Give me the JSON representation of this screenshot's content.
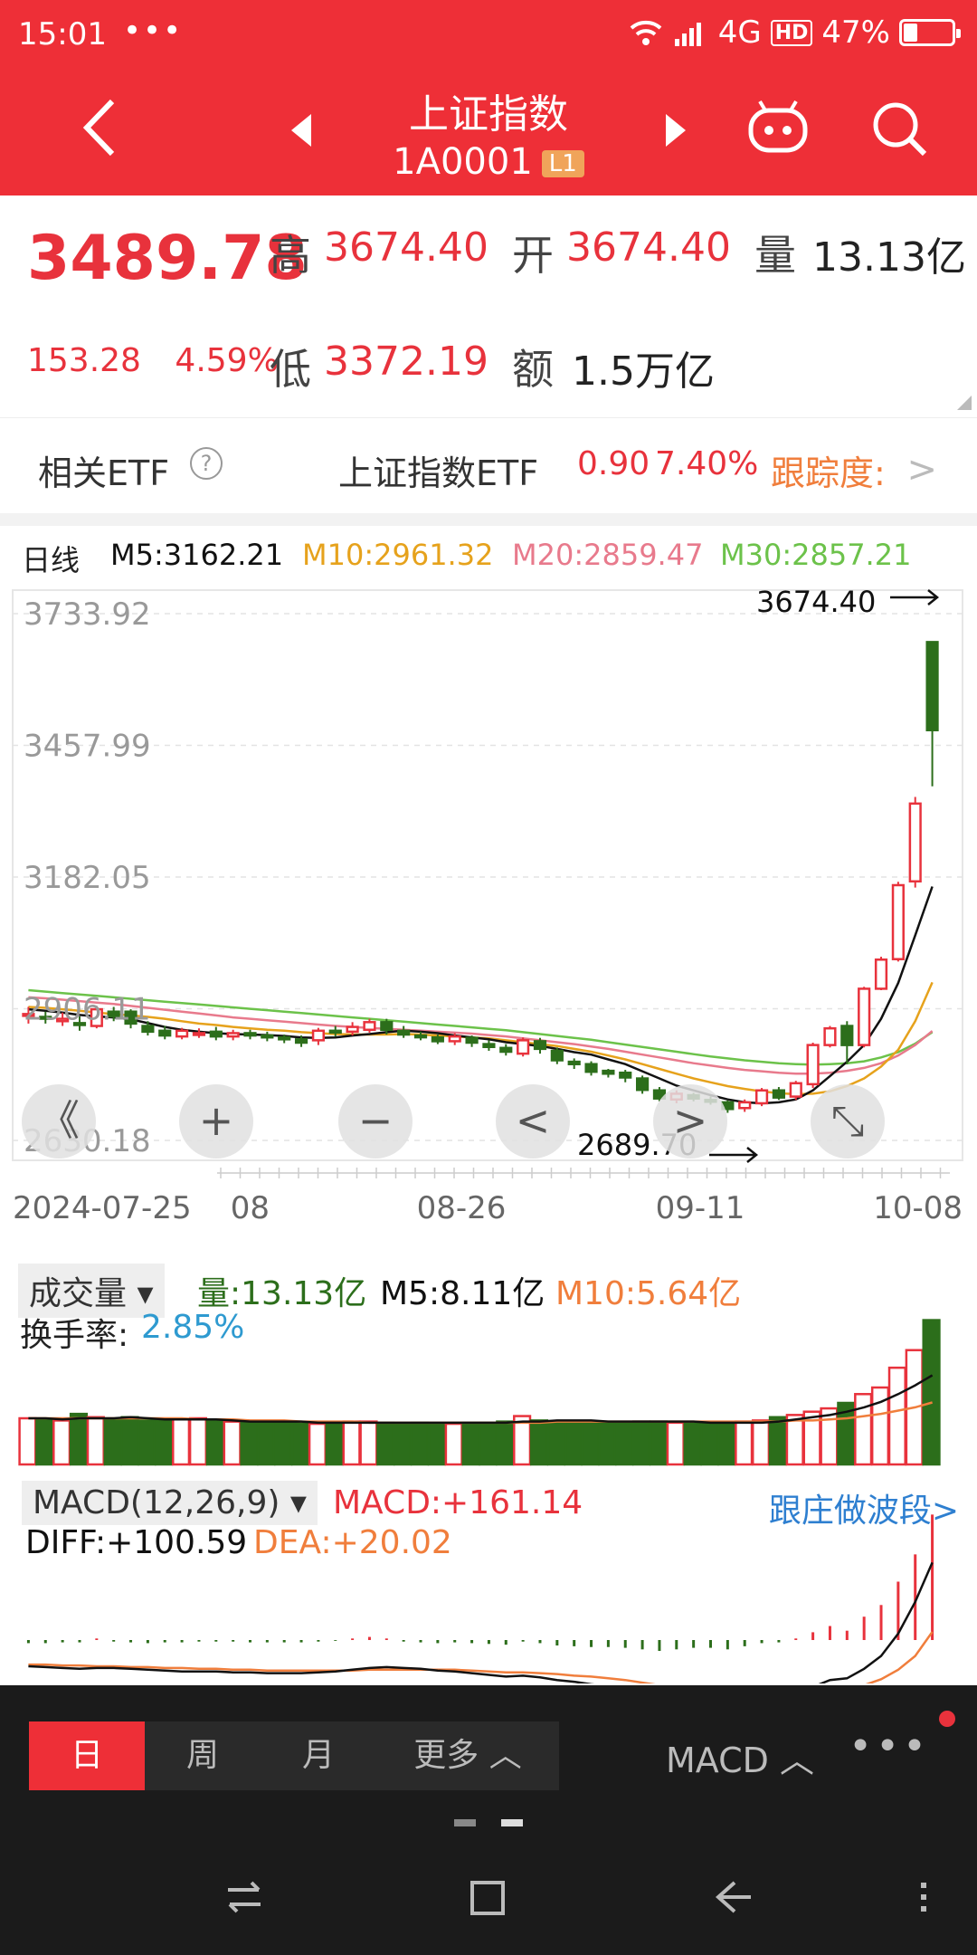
{
  "status": {
    "time": "15:01",
    "more": "•••",
    "network": "4G",
    "hd": "HD",
    "battery": "47%",
    "battery_level": 0.47
  },
  "header": {
    "title": "上证指数",
    "code": "1A0001",
    "level_badge": "L1"
  },
  "quote": {
    "price": "3489.78",
    "change": "153.28",
    "change_pct": "4.59%",
    "high_label": "高",
    "high": "3674.40",
    "open_label": "开",
    "open": "3674.40",
    "vol_label": "量",
    "volume": "13.13亿",
    "low_label": "低",
    "low": "3372.19",
    "amt_label": "额",
    "amount": "1.5万亿"
  },
  "etf": {
    "label": "相关ETF",
    "help": "?",
    "name": "上证指数ETF",
    "value": "0.90",
    "pct": "7.40%",
    "tracking": "跟踪度:",
    "chevron": ">"
  },
  "kline": {
    "period": "日线",
    "ma5": "M5:3162.21",
    "ma10": "M10:2961.32",
    "ma20": "M20:2859.47",
    "ma30": "M30:2857.21",
    "max_note": "3674.40",
    "min_note": "2689.70",
    "controls": {
      "first": "《",
      "zoom_in": "+",
      "zoom_out": "−",
      "prev": "<",
      "next": ">",
      "fullscreen": "⤡"
    }
  },
  "volume": {
    "selector": "成交量",
    "amount": "量:13.13亿",
    "ma5": "M5:8.11亿",
    "ma10": "M10:5.64亿",
    "turnover_label": "换手率:",
    "turnover": "2.85%"
  },
  "macd": {
    "selector": "MACD(12,26,9)",
    "macd": "MACD:+161.14",
    "diff": "DIFF:+100.59",
    "dea": "DEA:+20.02",
    "link": "跟庄做波段>"
  },
  "bottom": {
    "tabs": [
      "日",
      "周",
      "月",
      "更多 ︿"
    ],
    "indicator": "MACD ︿",
    "more": "•••"
  },
  "colors": {
    "up": "#e8323c",
    "down": "#2c6e1b",
    "ma5": "#111111",
    "ma10": "#e6a21c",
    "ma20": "#e87a8c",
    "ma30": "#6cc24a",
    "brand": "#ee2f37"
  },
  "chart_data": {
    "type": "candlestick",
    "x_ticks": [
      "2024-07-25",
      "08",
      "08-26",
      "09-11",
      "10-08"
    ],
    "y_ticks": [
      3733.92,
      3457.99,
      3182.05,
      2906.11,
      2630.18
    ],
    "ylim": [
      2630.18,
      3733.92
    ],
    "candles": [
      [
        2892,
        2895,
        2875,
        2910
      ],
      [
        2889,
        2886,
        2875,
        2900
      ],
      [
        2880,
        2885,
        2870,
        2898
      ],
      [
        2876,
        2872,
        2860,
        2890
      ],
      [
        2870,
        2905,
        2865,
        2912
      ],
      [
        2900,
        2890,
        2880,
        2910
      ],
      [
        2900,
        2875,
        2865,
        2905
      ],
      [
        2870,
        2858,
        2850,
        2880
      ],
      [
        2860,
        2850,
        2842,
        2870
      ],
      [
        2848,
        2860,
        2842,
        2866
      ],
      [
        2855,
        2855,
        2845,
        2865
      ],
      [
        2858,
        2848,
        2840,
        2868
      ],
      [
        2848,
        2855,
        2840,
        2862
      ],
      [
        2855,
        2850,
        2842,
        2862
      ],
      [
        2850,
        2846,
        2838,
        2858
      ],
      [
        2846,
        2842,
        2834,
        2852
      ],
      [
        2842,
        2835,
        2826,
        2850
      ],
      [
        2840,
        2860,
        2830,
        2866
      ],
      [
        2860,
        2858,
        2848,
        2870
      ],
      [
        2858,
        2868,
        2850,
        2878
      ],
      [
        2862,
        2878,
        2856,
        2885
      ],
      [
        2878,
        2862,
        2852,
        2885
      ],
      [
        2860,
        2852,
        2845,
        2870
      ],
      [
        2850,
        2848,
        2840,
        2858
      ],
      [
        2846,
        2838,
        2832,
        2852
      ],
      [
        2838,
        2848,
        2830,
        2855
      ],
      [
        2845,
        2835,
        2826,
        2850
      ],
      [
        2832,
        2826,
        2818,
        2840
      ],
      [
        2824,
        2816,
        2808,
        2832
      ],
      [
        2812,
        2840,
        2806,
        2846
      ],
      [
        2838,
        2822,
        2812,
        2845
      ],
      [
        2818,
        2798,
        2790,
        2825
      ],
      [
        2795,
        2790,
        2780,
        2802
      ],
      [
        2790,
        2774,
        2766,
        2796
      ],
      [
        2776,
        2770,
        2762,
        2780
      ],
      [
        2772,
        2762,
        2752,
        2778
      ],
      [
        2760,
        2736,
        2728,
        2766
      ],
      [
        2735,
        2718,
        2712,
        2742
      ],
      [
        2716,
        2728,
        2708,
        2735
      ],
      [
        2725,
        2718,
        2712,
        2730
      ],
      [
        2715,
        2712,
        2705,
        2722
      ],
      [
        2710,
        2696,
        2688,
        2714
      ],
      [
        2698,
        2710,
        2690,
        2716
      ],
      [
        2708,
        2735,
        2702,
        2740
      ],
      [
        2735,
        2720,
        2715,
        2742
      ],
      [
        2722,
        2750,
        2715,
        2755
      ],
      [
        2748,
        2830,
        2740,
        2835
      ],
      [
        2830,
        2865,
        2825,
        2870
      ],
      [
        2870,
        2830,
        2790,
        2880
      ],
      [
        2830,
        2948,
        2825,
        2952
      ],
      [
        2948,
        3009,
        2945,
        3015
      ],
      [
        3010,
        3165,
        3005,
        3172
      ],
      [
        3173,
        3336,
        3160,
        3350
      ],
      [
        3674.4,
        3489.78,
        3372.19,
        3674.4
      ]
    ],
    "ma5": [
      2905,
      2902,
      2898,
      2893,
      2890,
      2888,
      2884,
      2876,
      2868,
      2862,
      2858,
      2855,
      2853,
      2852,
      2851,
      2849,
      2846,
      2845,
      2846,
      2850,
      2853,
      2857,
      2860,
      2858,
      2855,
      2850,
      2846,
      2842,
      2836,
      2832,
      2828,
      2822,
      2815,
      2810,
      2800,
      2790,
      2775,
      2760,
      2745,
      2735,
      2725,
      2716,
      2710,
      2708,
      2710,
      2716,
      2735,
      2765,
      2795,
      2830,
      2885,
      2960,
      3060,
      3162.21
    ],
    "ma10": [
      2910,
      2908,
      2905,
      2902,
      2898,
      2895,
      2892,
      2889,
      2885,
      2880,
      2875,
      2872,
      2868,
      2865,
      2862,
      2860,
      2857,
      2855,
      2853,
      2852,
      2852,
      2852,
      2853,
      2852,
      2850,
      2848,
      2846,
      2844,
      2840,
      2836,
      2832,
      2828,
      2822,
      2816,
      2808,
      2800,
      2790,
      2780,
      2770,
      2760,
      2752,
      2744,
      2738,
      2733,
      2729,
      2727,
      2728,
      2733,
      2744,
      2760,
      2785,
      2820,
      2880,
      2961.32
    ],
    "ma20": [
      2930,
      2928,
      2925,
      2922,
      2919,
      2916,
      2912,
      2908,
      2904,
      2900,
      2896,
      2892,
      2888,
      2885,
      2882,
      2879,
      2876,
      2873,
      2870,
      2868,
      2866,
      2864,
      2862,
      2860,
      2858,
      2856,
      2854,
      2851,
      2848,
      2844,
      2840,
      2836,
      2832,
      2827,
      2822,
      2816,
      2810,
      2804,
      2798,
      2792,
      2787,
      2782,
      2778,
      2775,
      2772,
      2770,
      2770,
      2772,
      2776,
      2782,
      2792,
      2808,
      2830,
      2859.47
    ],
    "ma30": [
      2945,
      2942,
      2939,
      2936,
      2933,
      2930,
      2927,
      2924,
      2921,
      2918,
      2915,
      2912,
      2909,
      2906,
      2903,
      2900,
      2897,
      2894,
      2891,
      2888,
      2885,
      2882,
      2879,
      2876,
      2873,
      2870,
      2867,
      2864,
      2861,
      2857,
      2853,
      2849,
      2845,
      2841,
      2836,
      2831,
      2826,
      2821,
      2816,
      2811,
      2806,
      2802,
      2798,
      2795,
      2792,
      2790,
      2789,
      2790,
      2792,
      2796,
      2804,
      2815,
      2833,
      2857.21
    ],
    "volume": [
      4.2,
      4.1,
      4.0,
      4.6,
      4.3,
      4.1,
      4.3,
      4.0,
      4.0,
      4.1,
      4.2,
      4.0,
      3.9,
      3.8,
      3.8,
      3.9,
      3.8,
      3.7,
      3.8,
      3.9,
      3.9,
      3.8,
      3.7,
      3.8,
      3.7,
      3.7,
      3.8,
      3.8,
      3.9,
      4.4,
      4.0,
      3.9,
      3.9,
      3.9,
      3.8,
      3.8,
      3.9,
      3.9,
      3.8,
      3.8,
      3.8,
      3.8,
      3.9,
      4.0,
      4.3,
      4.5,
      4.8,
      5.1,
      5.6,
      6.4,
      7.0,
      8.8,
      10.4,
      13.13
    ],
    "vol_ma5": [
      4.2,
      4.2,
      4.1,
      4.2,
      4.2,
      4.2,
      4.3,
      4.2,
      4.1,
      4.1,
      4.1,
      4.1,
      4.0,
      3.9,
      3.9,
      3.9,
      3.9,
      3.8,
      3.8,
      3.8,
      3.8,
      3.8,
      3.8,
      3.8,
      3.8,
      3.8,
      3.8,
      3.8,
      3.8,
      3.9,
      3.9,
      4.0,
      4.0,
      4.0,
      3.9,
      3.9,
      3.9,
      3.9,
      3.9,
      3.9,
      3.8,
      3.8,
      3.8,
      3.8,
      3.9,
      4.1,
      4.3,
      4.5,
      4.8,
      5.2,
      5.7,
      6.4,
      7.2,
      8.11
    ],
    "vol_ma10": [
      4.2,
      4.2,
      4.2,
      4.2,
      4.2,
      4.2,
      4.2,
      4.2,
      4.2,
      4.2,
      4.1,
      4.1,
      4.1,
      4.0,
      4.0,
      4.0,
      3.9,
      3.9,
      3.9,
      3.9,
      3.8,
      3.8,
      3.8,
      3.8,
      3.8,
      3.8,
      3.8,
      3.8,
      3.8,
      3.8,
      3.8,
      3.9,
      3.9,
      3.9,
      3.9,
      3.9,
      3.9,
      3.9,
      3.9,
      3.9,
      3.9,
      3.9,
      3.9,
      3.9,
      3.9,
      4.0,
      4.0,
      4.1,
      4.2,
      4.4,
      4.6,
      4.9,
      5.2,
      5.64
    ],
    "macd_bar": [
      -4,
      -4,
      -3,
      -3,
      2,
      -2,
      -3,
      -4,
      -3,
      -3,
      -2,
      -2,
      -2,
      -3,
      -3,
      -3,
      -3,
      -2,
      -1,
      2,
      4,
      2,
      -2,
      -3,
      -4,
      -3,
      -4,
      -5,
      -6,
      -2,
      -4,
      -7,
      -8,
      -9,
      -9,
      -10,
      -12,
      -14,
      -12,
      -10,
      -10,
      -12,
      -8,
      -4,
      -3,
      2,
      10,
      18,
      12,
      30,
      45,
      75,
      110,
      161.14
    ],
    "diff": [
      -20,
      -21,
      -22,
      -23,
      -22,
      -22,
      -23,
      -24,
      -25,
      -26,
      -26,
      -26,
      -27,
      -27,
      -28,
      -28,
      -28,
      -27,
      -26,
      -24,
      -22,
      -21,
      -22,
      -23,
      -25,
      -26,
      -28,
      -30,
      -32,
      -31,
      -33,
      -36,
      -38,
      -41,
      -43,
      -46,
      -50,
      -54,
      -55,
      -56,
      -57,
      -59,
      -58,
      -55,
      -54,
      -51,
      -44,
      -36,
      -34,
      -23,
      -8,
      18,
      55,
      100.59
    ],
    "dea": [
      -18,
      -18,
      -19,
      -19,
      -20,
      -20,
      -21,
      -21,
      -22,
      -22,
      -23,
      -23,
      -24,
      -24,
      -25,
      -25,
      -25,
      -25,
      -25,
      -25,
      -24,
      -24,
      -24,
      -24,
      -24,
      -24,
      -25,
      -26,
      -27,
      -27,
      -28,
      -29,
      -31,
      -32,
      -34,
      -36,
      -39,
      -42,
      -45,
      -47,
      -49,
      -51,
      -53,
      -54,
      -54,
      -54,
      -52,
      -49,
      -46,
      -42,
      -35,
      -24,
      -8,
      20.02
    ]
  }
}
